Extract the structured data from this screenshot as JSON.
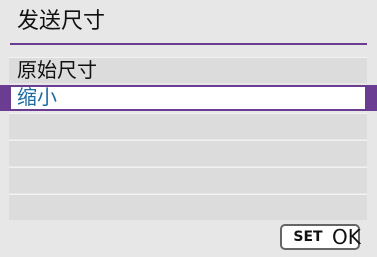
{
  "header": {
    "title": "发送尺寸"
  },
  "menu": {
    "items": [
      {
        "label": "原始尺寸",
        "selected": false
      },
      {
        "label": "缩小",
        "selected": true
      },
      {
        "label": ""
      },
      {
        "label": ""
      },
      {
        "label": ""
      },
      {
        "label": ""
      }
    ]
  },
  "footer": {
    "set_label": "SET",
    "ok_label": "OK"
  },
  "colors": {
    "accent": "#6a3d92",
    "selected_text": "#1d6aa3",
    "background": "#e7e7e7"
  }
}
